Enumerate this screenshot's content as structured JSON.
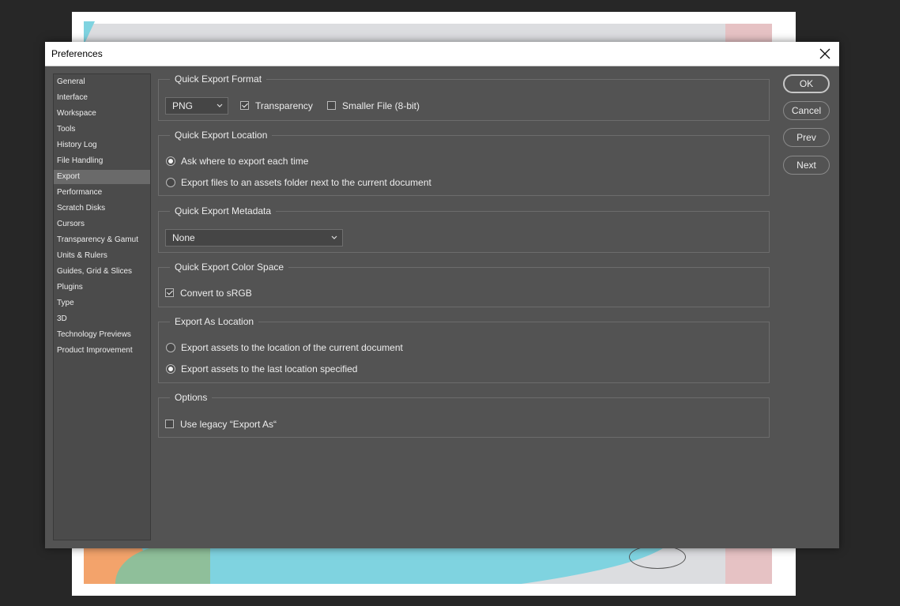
{
  "dialog": {
    "title": "Preferences"
  },
  "sidebar": {
    "items": [
      {
        "label": "General"
      },
      {
        "label": "Interface"
      },
      {
        "label": "Workspace"
      },
      {
        "label": "Tools"
      },
      {
        "label": "History Log"
      },
      {
        "label": "File Handling"
      },
      {
        "label": "Export"
      },
      {
        "label": "Performance"
      },
      {
        "label": "Scratch Disks"
      },
      {
        "label": "Cursors"
      },
      {
        "label": "Transparency & Gamut"
      },
      {
        "label": "Units & Rulers"
      },
      {
        "label": "Guides, Grid & Slices"
      },
      {
        "label": "Plugins"
      },
      {
        "label": "Type"
      },
      {
        "label": "3D"
      },
      {
        "label": "Technology Previews"
      },
      {
        "label": "Product Improvement"
      }
    ],
    "selected": "Export"
  },
  "quick_export_format": {
    "legend": "Quick Export Format",
    "format_value": "PNG",
    "transparency_label": "Transparency",
    "transparency_checked": true,
    "smaller_file_label": "Smaller File (8-bit)",
    "smaller_file_checked": false
  },
  "quick_export_location": {
    "legend": "Quick Export Location",
    "options": [
      {
        "label": "Ask where to export each time",
        "selected": true
      },
      {
        "label": "Export files to an assets folder next to the current document",
        "selected": false
      }
    ]
  },
  "quick_export_metadata": {
    "legend": "Quick Export Metadata",
    "value": "None"
  },
  "quick_export_color_space": {
    "legend": "Quick Export Color Space",
    "convert_label": "Convert to sRGB",
    "convert_checked": true
  },
  "export_as_location": {
    "legend": "Export As Location",
    "options": [
      {
        "label": "Export assets to the location of the current document",
        "selected": false
      },
      {
        "label": "Export assets to the last location specified",
        "selected": true
      }
    ]
  },
  "options": {
    "legend": "Options",
    "legacy_label": "Use legacy “Export As“",
    "legacy_checked": false
  },
  "buttons": {
    "ok": "OK",
    "cancel": "Cancel",
    "prev": "Prev",
    "next": "Next"
  },
  "colors": {
    "dialog_bg": "#535353",
    "sidebar_bg": "#4b4b4b",
    "selected_item_bg": "#6a6a6a",
    "text": "#ededed"
  }
}
